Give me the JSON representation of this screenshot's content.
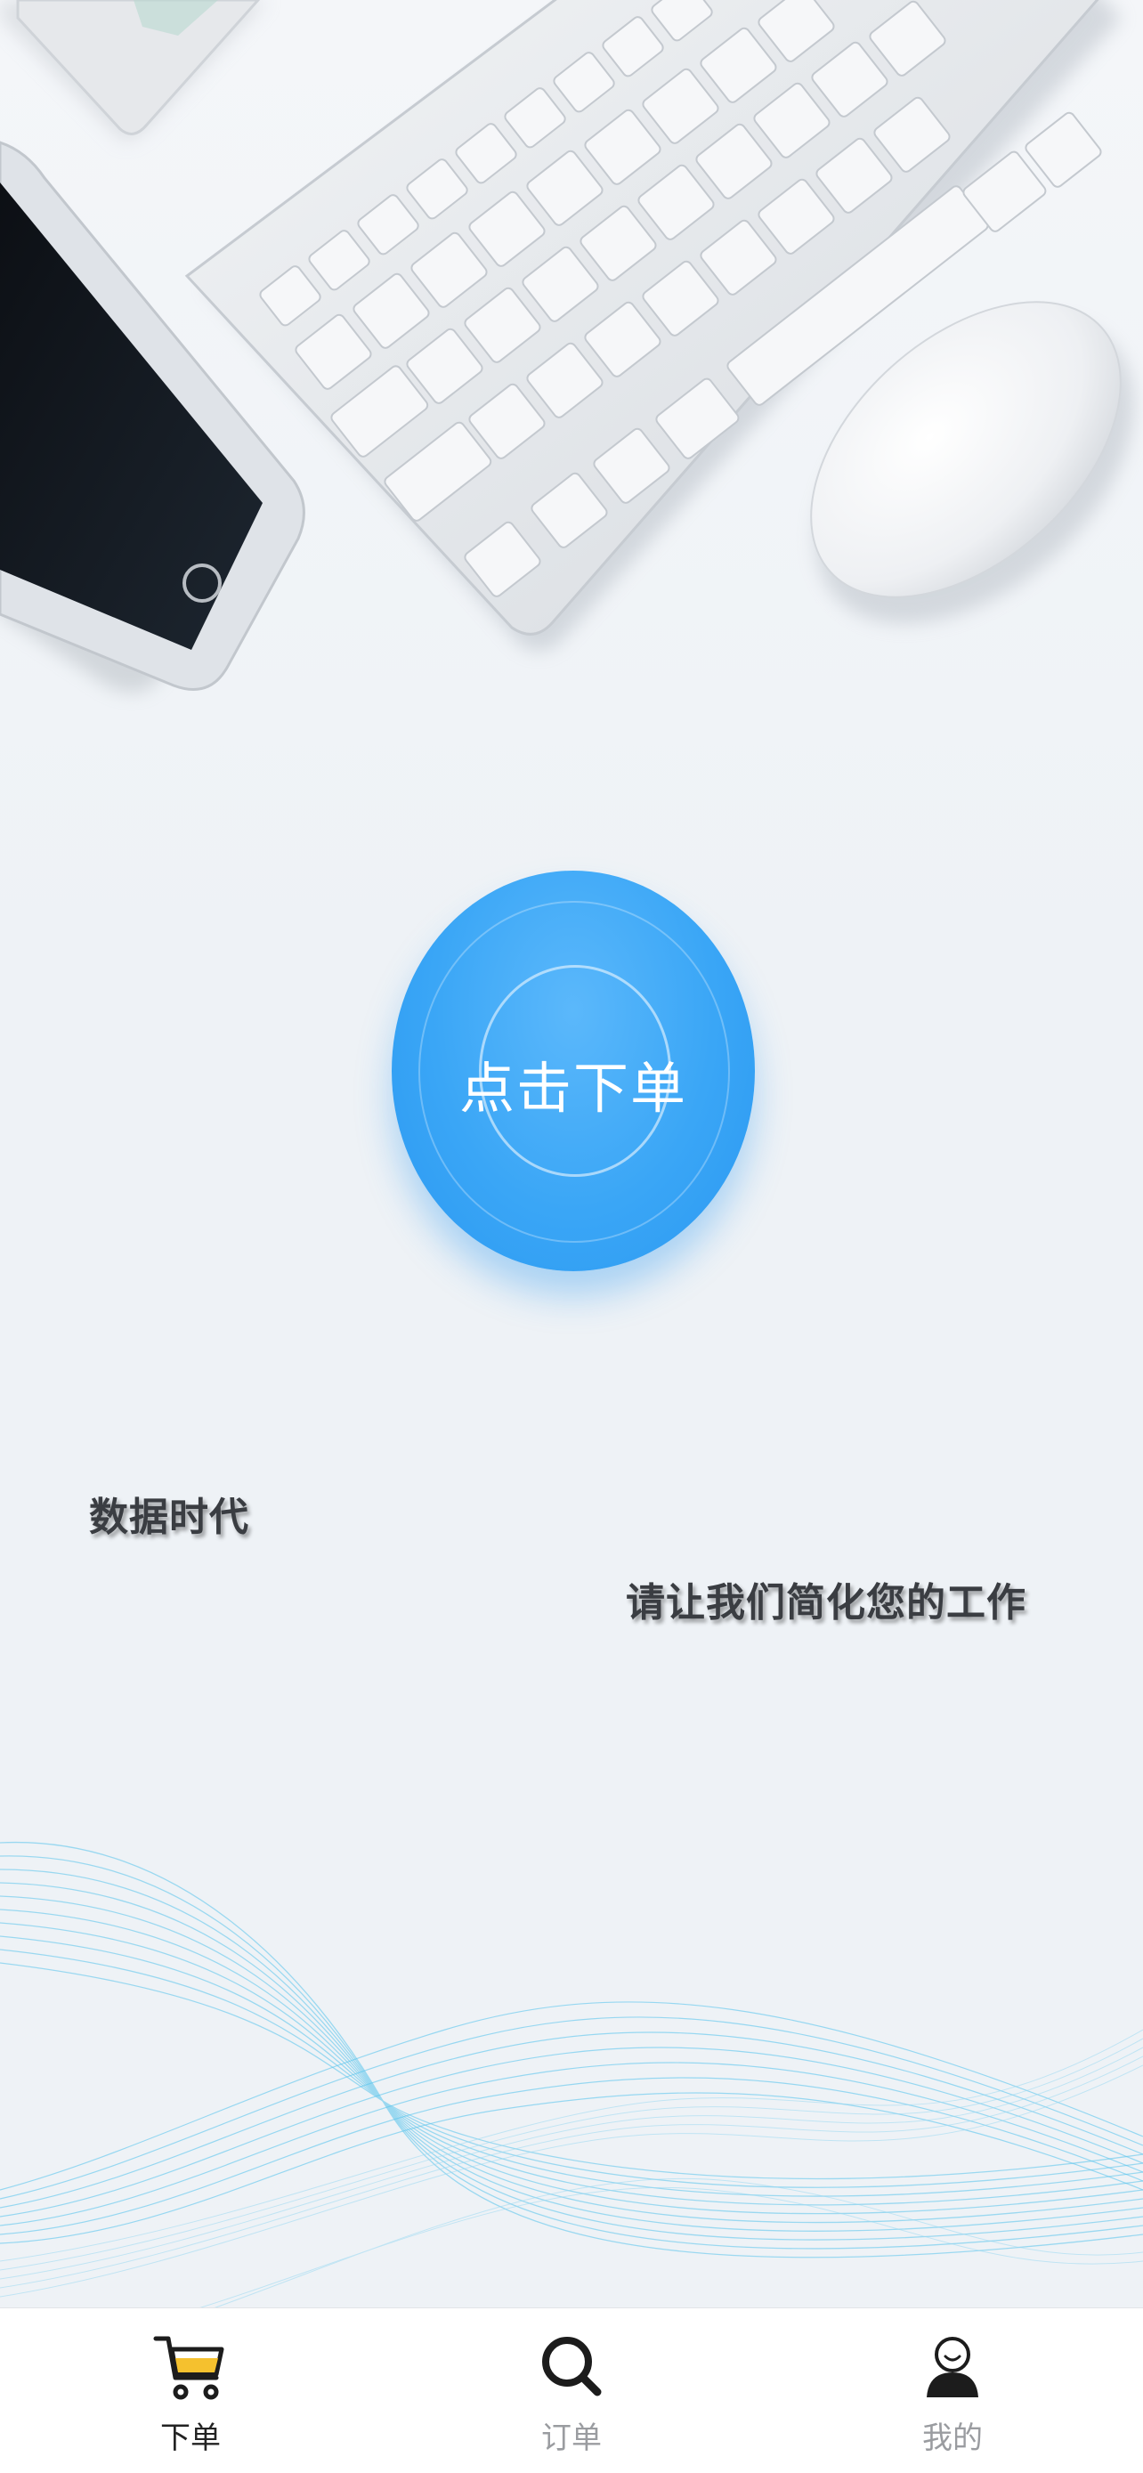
{
  "main": {
    "order_button_label": "点击下单",
    "slogan_primary": "数据时代",
    "slogan_secondary": "请让我们简化您的工作"
  },
  "tabbar": {
    "tabs": [
      {
        "label": "下单",
        "icon": "shopping-cart-icon",
        "active": true
      },
      {
        "label": "订单",
        "icon": "search-icon",
        "active": false
      },
      {
        "label": "我的",
        "icon": "user-profile-icon",
        "active": false
      }
    ]
  },
  "colors": {
    "accent_blue": "#2a98f1",
    "cart_yellow": "#f5c12e",
    "text_dark": "#3a3d42",
    "text_inactive": "#9a9ca0",
    "background": "#eef2f6"
  }
}
